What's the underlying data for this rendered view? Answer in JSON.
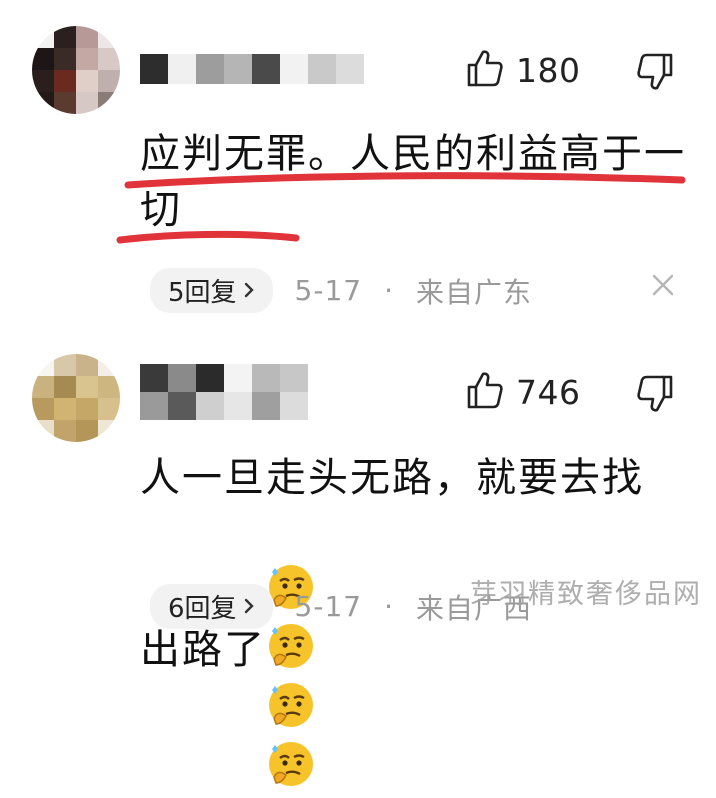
{
  "comments": [
    {
      "likes": "180",
      "text": "应判无罪。人民的利益高于一切",
      "reply_label": "5回复",
      "date": "5-17",
      "separator": "·",
      "location": "来自广东",
      "emoji_names": []
    },
    {
      "likes": "746",
      "text": "人一旦走头无路，就要去找出路了",
      "reply_label": "6回复",
      "date": "5-17",
      "separator": "·",
      "location": "来自广西",
      "emoji_names": [
        "thinking-face-emoji",
        "thinking-face-emoji",
        "thinking-face-emoji",
        "thinking-face-emoji"
      ]
    }
  ],
  "watermark": "芽羽精致奢侈品网",
  "colors": {
    "underline": "#e0333a",
    "meta_gray": "#9a9a9a",
    "pill_bg": "#f2f2f2"
  },
  "icons": {
    "like": "thumbs-up-icon",
    "dislike": "thumbs-down-icon",
    "close": "close-icon",
    "chevron": "chevron-right-icon"
  }
}
